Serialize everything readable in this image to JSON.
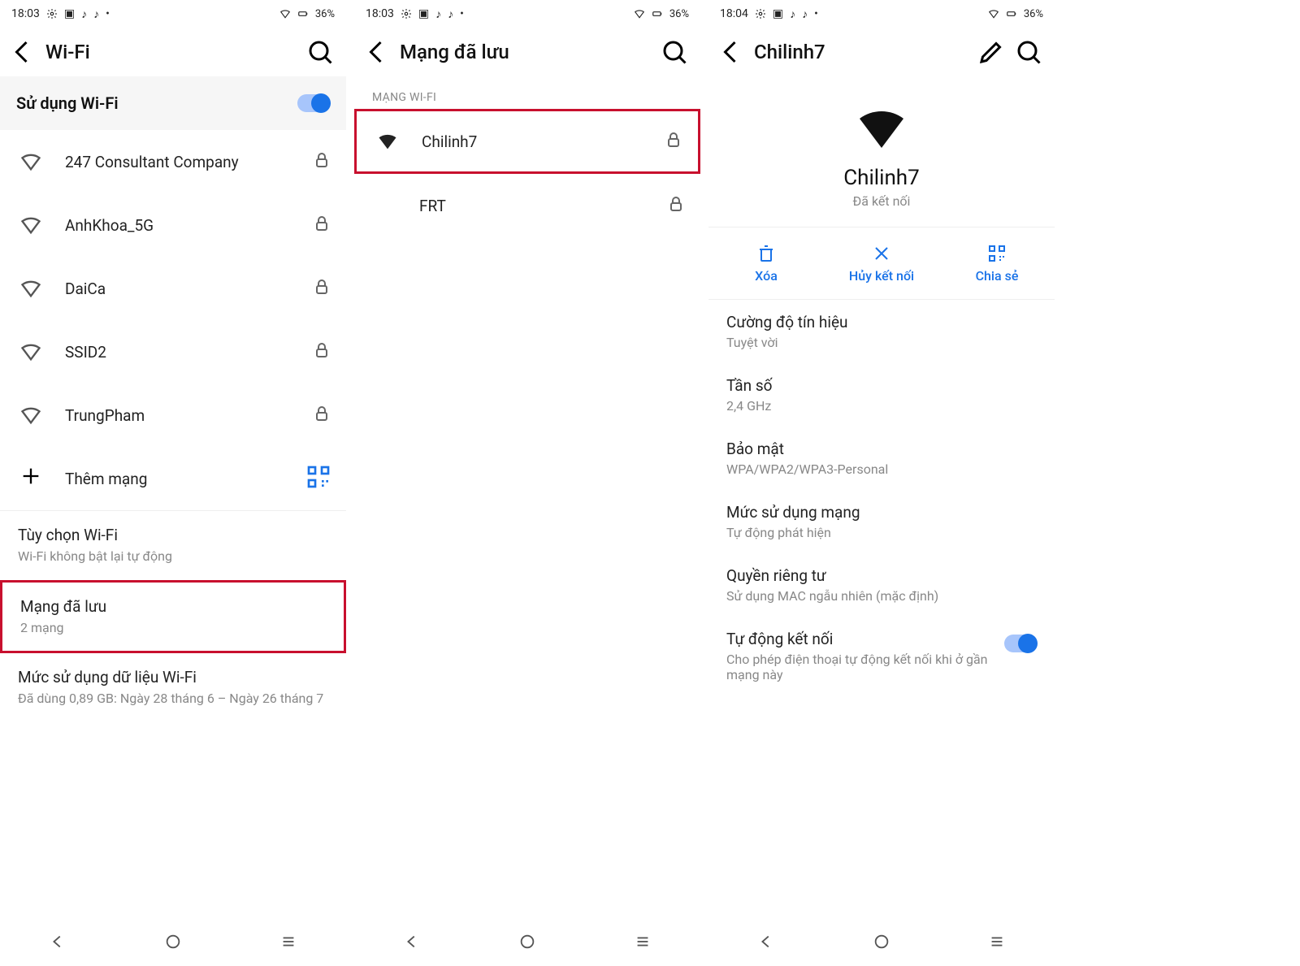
{
  "status": {
    "time_a": "18:03",
    "time_b": "18:03",
    "time_c": "18:04",
    "battery": "36%"
  },
  "screen1": {
    "title": "Wi-Fi",
    "use_wifi_label": "Sử dụng Wi-Fi",
    "networks": [
      "247 Consultant Company",
      "AnhKhoa_5G",
      "DaiCa",
      "SSID2",
      "TrungPham"
    ],
    "add_network": "Thêm mạng",
    "options": {
      "pref_t": "Tùy chọn Wi-Fi",
      "pref_s": "Wi-Fi không bật lại tự động",
      "saved_t": "Mạng đã lưu",
      "saved_s": "2 mạng",
      "usage_t": "Mức sử dụng dữ liệu Wi-Fi",
      "usage_s": "Đã dùng 0,89 GB: Ngày 28 tháng 6 – Ngày 26 tháng 7"
    }
  },
  "screen2": {
    "title": "Mạng đã lưu",
    "section": "MẠNG WI-FI",
    "networks": [
      "Chilinh7",
      "FRT"
    ]
  },
  "screen3": {
    "title": "Chilinh7",
    "net_name": "Chilinh7",
    "net_status": "Đã kết nối",
    "actions": {
      "delete": "Xóa",
      "disconnect": "Hủy kết nối",
      "share": "Chia sẻ"
    },
    "details": {
      "signal_t": "Cường độ tín hiệu",
      "signal_s": "Tuyệt vời",
      "freq_t": "Tần số",
      "freq_s": "2,4 GHz",
      "sec_t": "Bảo mật",
      "sec_s": "WPA/WPA2/WPA3-Personal",
      "usage_t": "Mức sử dụng mạng",
      "usage_s": "Tự động phát hiện",
      "priv_t": "Quyền riêng tư",
      "priv_s": "Sử dụng MAC ngẫu nhiên (mặc định)",
      "auto_t": "Tự động kết nối",
      "auto_s": "Cho phép điện thoại tự động kết nối khi ở gần mạng này"
    }
  }
}
